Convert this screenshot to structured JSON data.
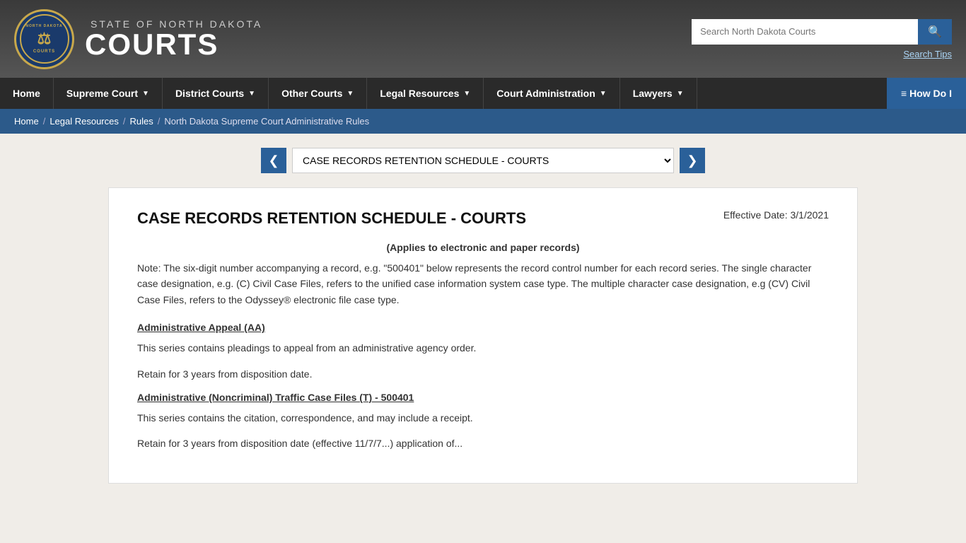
{
  "header": {
    "seal_label": "North Dakota Courts Seal",
    "state_line": "STATE OF NORTH DAKOTA",
    "courts_line": "COURTS",
    "search_placeholder": "Search North Dakota Courts",
    "search_tips_label": "Search Tips"
  },
  "nav": {
    "items": [
      {
        "label": "Home",
        "has_arrow": false
      },
      {
        "label": "Supreme Court",
        "has_arrow": true
      },
      {
        "label": "District Courts",
        "has_arrow": true
      },
      {
        "label": "Other Courts",
        "has_arrow": true
      },
      {
        "label": "Legal Resources",
        "has_arrow": true
      },
      {
        "label": "Court Administration",
        "has_arrow": true
      },
      {
        "label": "Lawyers",
        "has_arrow": true
      }
    ],
    "howdoi_label": "≡ How Do I"
  },
  "breadcrumb": {
    "items": [
      {
        "label": "Home",
        "is_link": true
      },
      {
        "label": "Legal Resources",
        "is_link": true
      },
      {
        "label": "Rules",
        "is_link": true
      },
      {
        "label": "North Dakota Supreme Court Administrative Rules",
        "is_link": false
      }
    ]
  },
  "doc_nav": {
    "prev_label": "❮",
    "next_label": "❯",
    "current_value": "CASE RECORDS RETENTION SCHEDULE - COURTS",
    "options": [
      "CASE RECORDS RETENTION SCHEDULE - COURTS"
    ]
  },
  "document": {
    "title": "CASE RECORDS RETENTION SCHEDULE - COURTS",
    "effective_date": "Effective Date: 3/1/2021",
    "subtitle": "(Applies to electronic and paper records)",
    "note": "Note: The six-digit number accompanying a record, e.g. \"500401\" below represents the record control number for each record series. The single character case designation, e.g. (C) Civil Case Files, refers to the unified case information system case type. The multiple character case designation, e.g (CV) Civil Case Files, refers to the Odyssey® electronic file case type.",
    "section1_title": "Administrative Appeal (AA)",
    "section1_para1": "This series contains pleadings to appeal from an administrative agency order.",
    "section1_para2": "Retain for 3 years from disposition date.",
    "section2_title": "Administrative (Noncriminal) Traffic Case Files (T) - 500401",
    "section2_para1": "This series contains the citation, correspondence, and may include a receipt.",
    "section2_para2": "Retain for 3 years from disposition date (effective 11/7/7...) application of..."
  }
}
